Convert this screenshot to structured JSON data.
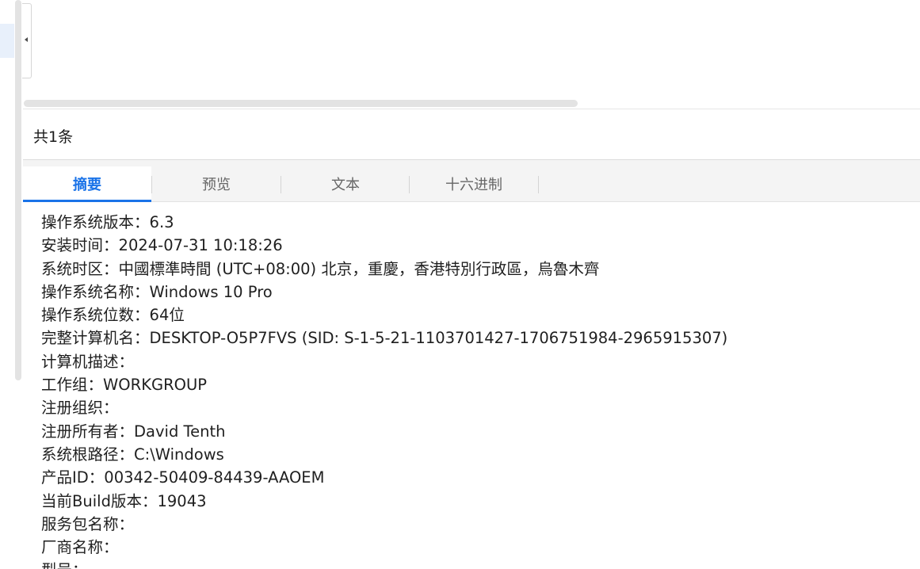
{
  "count_bar": {
    "text": "共1条"
  },
  "tabs": [
    {
      "label": "摘要",
      "active": true
    },
    {
      "label": "预览",
      "active": false
    },
    {
      "label": "文本",
      "active": false
    },
    {
      "label": "十六进制",
      "active": false
    }
  ],
  "summary": [
    {
      "label": "操作系统版本",
      "value": "6.3"
    },
    {
      "label": "安装时间",
      "value": "2024-07-31 10:18:26"
    },
    {
      "label": "系统时区",
      "value": "中國標準時間 (UTC+08:00) 北京，重慶，香港特別行政區，烏魯木齊"
    },
    {
      "label": "操作系统名称",
      "value": "Windows 10 Pro"
    },
    {
      "label": "操作系统位数",
      "value": "64位"
    },
    {
      "label": "完整计算机名",
      "value": "DESKTOP-O5P7FVS (SID: S-1-5-21-1103701427-1706751984-2965915307)"
    },
    {
      "label": "计算机描述",
      "value": ""
    },
    {
      "label": "工作组",
      "value": "WORKGROUP"
    },
    {
      "label": "注册组织",
      "value": ""
    },
    {
      "label": "注册所有者",
      "value": "David Tenth"
    },
    {
      "label": "系统根路径",
      "value": "C:\\Windows"
    },
    {
      "label": "产品ID",
      "value": "00342-50409-84439-AAOEM"
    },
    {
      "label": "当前Build版本",
      "value": "19043"
    },
    {
      "label": "服务包名称",
      "value": ""
    },
    {
      "label": "厂商名称",
      "value": ""
    },
    {
      "label": "型号",
      "value": ""
    }
  ],
  "colors": {
    "accent": "#1a73e8",
    "tab_bg": "#f4f4f4",
    "text": "#1f1f1f"
  },
  "icons": {
    "collapse_handle": "caret-left-icon"
  }
}
